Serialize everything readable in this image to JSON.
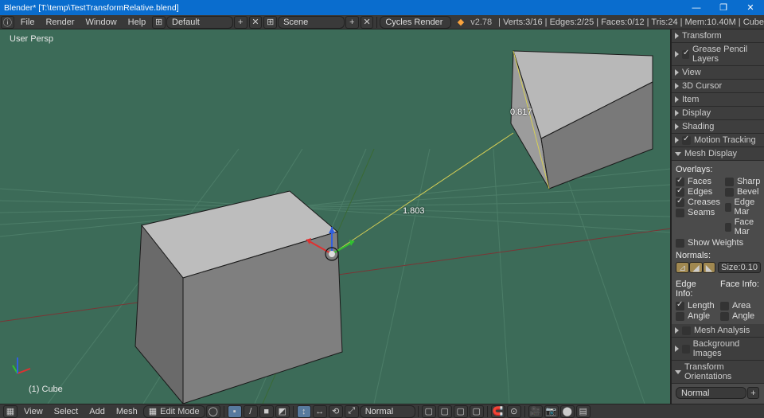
{
  "titlebar": {
    "title": "Blender* [T:\\temp\\TestTransformRelative.blend]"
  },
  "topmenu": [
    "File",
    "Render",
    "Window",
    "Help"
  ],
  "top": {
    "layout_field": "Default",
    "scene_field": "Scene",
    "engine": "Cycles Render",
    "version": "v2.78",
    "stats": "Verts:3/16 | Edges:2/25 | Faces:0/12 | Tris:24 | Mem:10.40M | Cube"
  },
  "viewport": {
    "persp": "User Persp",
    "object": "(1) Cube",
    "measure1": "1.803",
    "measure2": "0.817"
  },
  "npanels": {
    "transform": "Transform",
    "grease": "Grease Pencil Layers",
    "view": "View",
    "cursor3d": "3D Cursor",
    "item": "Item",
    "display": "Display",
    "shading": "Shading",
    "motion": "Motion Tracking",
    "meshdisp": "Mesh Display",
    "overlays": "Overlays:",
    "faces": "Faces",
    "edges": "Edges",
    "creases": "Creases",
    "seams": "Seams",
    "show_weights": "Show Weights",
    "sharp": "Sharp",
    "bevel": "Bevel",
    "edgemar": "Edge Mar",
    "facemar": "Face Mar",
    "normals": "Normals:",
    "size_lbl": "Size:",
    "size_val": "0.10",
    "edgeinfo": "Edge Info:",
    "faceinfo": "Face Info:",
    "length": "Length",
    "angle": "Angle",
    "area": "Area",
    "angle2": "Angle",
    "mesh_analysis": "Mesh Analysis",
    "bg_images": "Background Images",
    "torient": "Transform Orientations",
    "orient_val": "Normal"
  },
  "bottom": {
    "view": "View",
    "select": "Select",
    "add": "Add",
    "mesh": "Mesh",
    "mode": "Edit Mode",
    "orient": "Normal"
  }
}
